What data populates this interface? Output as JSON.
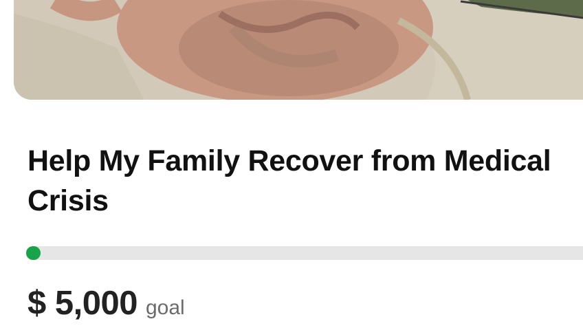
{
  "campaign": {
    "hero_image": "campaign-photo",
    "title": "Help My Family Recover from Medical Crisis",
    "progress_percent": 1,
    "goal": {
      "amount": "$ 5,000",
      "label": "goal"
    }
  },
  "colors": {
    "progress_fill": "#16a34a",
    "progress_track": "#e6e6e6",
    "title_text": "#111111",
    "goal_label_text": "#6b6b6b"
  }
}
